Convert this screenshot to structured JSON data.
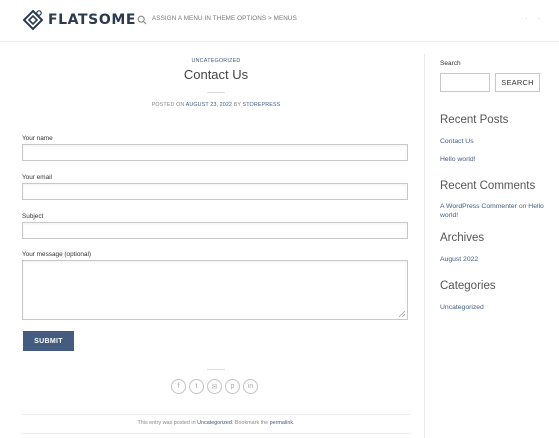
{
  "header": {
    "logo_text": "FLATSOME",
    "menu_note": "ASSIGN A MENU IN THEME OPTIONS > MENUS",
    "right_marks": [
      "·",
      "·"
    ]
  },
  "post": {
    "category": "UNCATEGORIZED",
    "title": "Contact Us",
    "meta_prefix": "POSTED ON",
    "meta_date": "AUGUST 23, 2022",
    "meta_by": "BY",
    "meta_author": "STOREPRESS"
  },
  "form": {
    "name_label": "Your name",
    "email_label": "Your email",
    "subject_label": "Subject",
    "message_label": "Your message (optional)",
    "submit_label": "SUBMIT"
  },
  "share": {
    "icons": [
      "facebook-icon",
      "twitter-icon",
      "email-icon",
      "pinterest-icon",
      "linkedin-icon"
    ],
    "glyphs": [
      "f",
      "t",
      "✉",
      "p",
      "in"
    ]
  },
  "entry_footer": {
    "prefix": "This entry was posted in",
    "category_link": "Uncategorized",
    "middle": ". Bookmark the",
    "permalink": "permalink",
    "suffix": "."
  },
  "sidebar": {
    "search_label": "Search",
    "search_button": "SEARCH",
    "recent_posts_heading": "Recent Posts",
    "recent_posts": [
      "Contact Us",
      "Hello world!"
    ],
    "recent_comments_heading": "Recent Comments",
    "comment_author": "A WordPress Commenter",
    "comment_on": "on",
    "comment_post": "Hello world!",
    "archives_heading": "Archives",
    "archives": [
      "August 2022"
    ],
    "categories_heading": "Categories",
    "categories": [
      "Uncategorized"
    ]
  },
  "colors": {
    "accent": "#445c80",
    "logo": "#2b3a4f"
  }
}
